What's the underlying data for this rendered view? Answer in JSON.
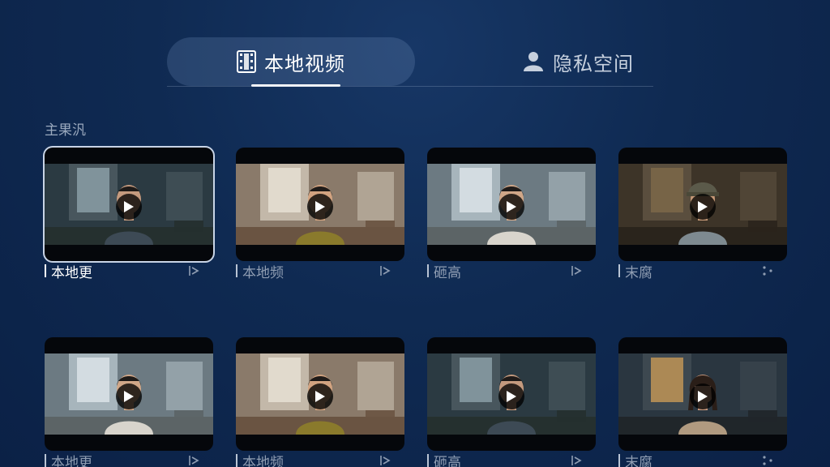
{
  "tabs": [
    {
      "label": "本地视频",
      "icon": "film-icon",
      "active": true
    },
    {
      "label": "隐私空间",
      "icon": "user-icon",
      "active": false
    }
  ],
  "section": {
    "title": "主果汎"
  },
  "videos": [
    {
      "title": "本地更",
      "scene": "dark-room",
      "selected": true
    },
    {
      "title": "本地频",
      "scene": "warm-room",
      "selected": false
    },
    {
      "title": "砸高",
      "scene": "misty-room",
      "selected": false
    },
    {
      "title": "末腐",
      "scene": "cap-boy",
      "selected": false
    },
    {
      "title": "本地更",
      "scene": "misty-room",
      "selected": false
    },
    {
      "title": "本地频",
      "scene": "warm-room",
      "selected": false
    },
    {
      "title": "砸高",
      "scene": "dark-room",
      "selected": false
    },
    {
      "title": "末腐",
      "scene": "girl-room",
      "selected": false
    }
  ],
  "colors": {
    "background": "#0f2a52",
    "active_tab": "#ffffff",
    "caption_text": "#8f9db2"
  }
}
